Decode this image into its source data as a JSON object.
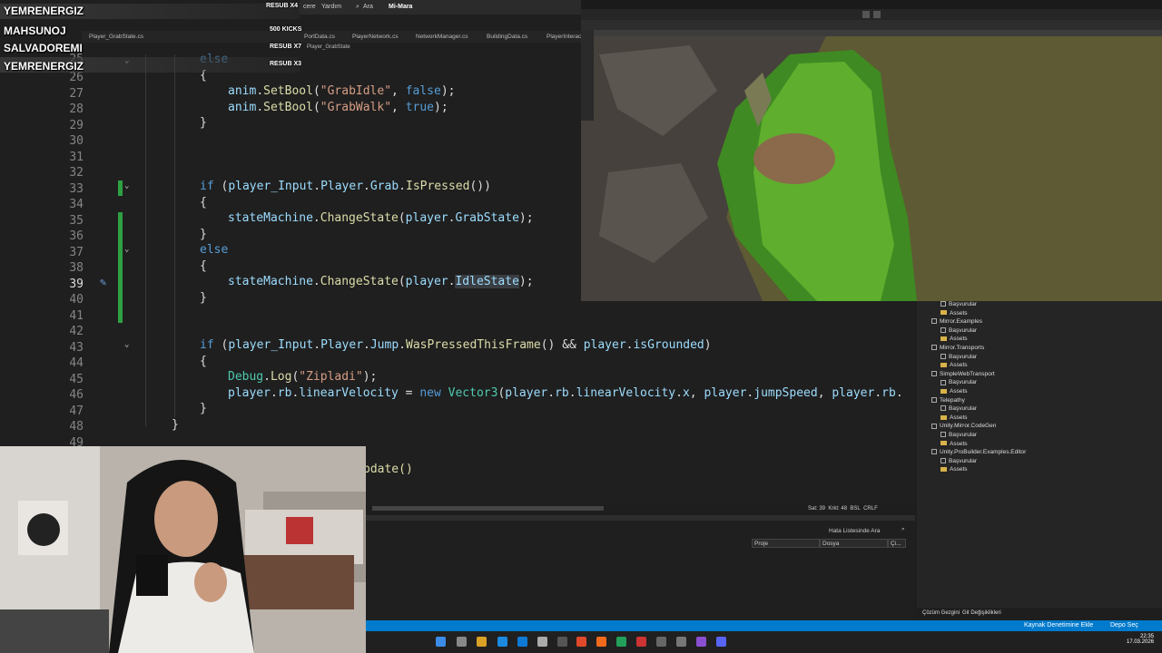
{
  "overlay": {
    "names": [
      "YEMRENERGIZ",
      "MAHSUNOJ",
      "SALVADOREMI",
      "YEMRENERGIZ"
    ],
    "resub": [
      "RESUB X4",
      "500 KICKS",
      "RESUB X7",
      "RESUB X3"
    ]
  },
  "vs": {
    "menu": [
      "cere",
      "Yardım",
      "Ara",
      "Mi-Mara"
    ],
    "tabs": [
      "Player_GrabState.cs",
      "PortData.cs",
      "PlayerNetwork.cs",
      "NetworkManager.cs",
      "BuildingData.cs",
      "PlayerInteract"
    ],
    "breadcrumb": "Player_GrabState",
    "line_numbers": [
      "25",
      "26",
      "27",
      "28",
      "29",
      "30",
      "31",
      "32",
      "33",
      "34",
      "35",
      "36",
      "37",
      "38",
      "39",
      "40",
      "41",
      "42",
      "43",
      "44",
      "45",
      "46",
      "47",
      "48",
      "49"
    ],
    "active_line": "39",
    "status": {
      "line": "Sat: 39",
      "char": "Krkt: 48",
      "spc": "BSL",
      "eol": "CRLF"
    },
    "error_list": {
      "search": "Hata Listesinde Ara",
      "col_project": "Proje",
      "col_file": "Dosya",
      "col_line": "Çi..."
    },
    "partial_code": "pdate()"
  },
  "project": {
    "items": [
      {
        "label": "Başvurular",
        "kind": "ref"
      },
      {
        "label": "Assets",
        "kind": "folder"
      },
      {
        "label": "Mirror.Examples",
        "kind": "proj"
      },
      {
        "label": "Başvurular",
        "kind": "ref"
      },
      {
        "label": "Assets",
        "kind": "folder"
      },
      {
        "label": "Mirror.Transports",
        "kind": "proj"
      },
      {
        "label": "Başvurular",
        "kind": "ref"
      },
      {
        "label": "Assets",
        "kind": "folder"
      },
      {
        "label": "SimpleWebTransport",
        "kind": "proj"
      },
      {
        "label": "Başvurular",
        "kind": "ref"
      },
      {
        "label": "Assets",
        "kind": "folder"
      },
      {
        "label": "Telepathy",
        "kind": "proj"
      },
      {
        "label": "Başvurular",
        "kind": "ref"
      },
      {
        "label": "Assets",
        "kind": "folder"
      },
      {
        "label": "Unity.Mirror.CodeGen",
        "kind": "proj"
      },
      {
        "label": "Başvurular",
        "kind": "ref"
      },
      {
        "label": "Assets",
        "kind": "folder"
      },
      {
        "label": "Unity.ProBuilder.Examples.Editor",
        "kind": "proj"
      },
      {
        "label": "Başvurular",
        "kind": "ref"
      },
      {
        "label": "Assets",
        "kind": "folder"
      }
    ],
    "footer_tabs": [
      "Çözüm Gezgini",
      "Git Değişiklikleri"
    ]
  },
  "statusbar": {
    "source_control": "Kaynak Denetimine Ekle",
    "repo": "Depo Seç"
  },
  "taskbar": {
    "time": "22:35",
    "date": "17.03.2026"
  },
  "colors": {
    "keyword": "#569cd6",
    "string": "#d69d85",
    "method": "#dcdcaa",
    "type": "#4ec9b0",
    "change": "#2ea043",
    "status": "#007acc"
  }
}
